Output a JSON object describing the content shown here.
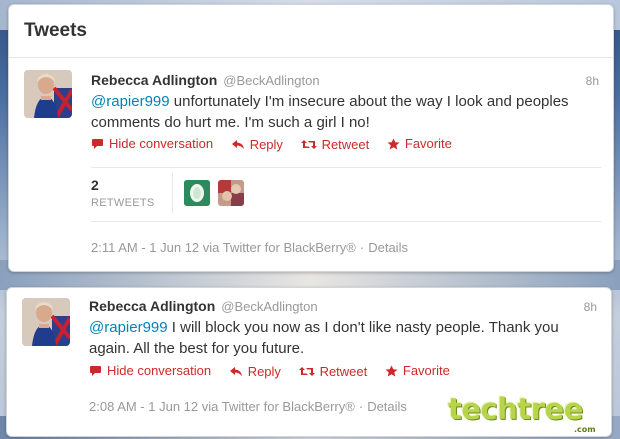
{
  "header": {
    "title": "Tweets"
  },
  "tweets": [
    {
      "fullname": "Rebecca Adlington",
      "username": "@BeckAdlington",
      "time": "8h",
      "mention": "@rapier999",
      "text": " unfortunately I'm insecure about the way I look and peoples comments do hurt me. I'm such a girl I no!",
      "actions": {
        "hide": "Hide conversation",
        "reply": "Reply",
        "retweet": "Retweet",
        "favorite": "Favorite"
      },
      "retweet_count": "2",
      "retweet_label": "RETWEETS",
      "meta": {
        "datetime": "2:11 AM - 1 Jun 12 via Twitter for BlackBerry®",
        "separator": "·",
        "details": "Details"
      }
    },
    {
      "fullname": "Rebecca Adlington",
      "username": "@BeckAdlington",
      "time": "8h",
      "mention": "@rapier999",
      "text": " I will block you now as I don't like nasty people. Thank you again. All the best for you future.",
      "actions": {
        "hide": "Hide conversation",
        "reply": "Reply",
        "retweet": "Retweet",
        "favorite": "Favorite"
      },
      "meta": {
        "datetime": "2:08 AM - 1 Jun 12 via Twitter for BlackBerry®",
        "separator": "·",
        "details": "Details"
      }
    }
  ],
  "watermark": {
    "brand": "techtree",
    "suffix": ".com"
  },
  "colors": {
    "action_red": "#cc2a2a",
    "mention_blue": "#0084b4",
    "watermark_green": "#b7d44b"
  },
  "icons": {
    "hide": "speech-bubble-icon",
    "reply": "reply-arrow-icon",
    "retweet": "retweet-icon",
    "favorite": "star-icon"
  }
}
